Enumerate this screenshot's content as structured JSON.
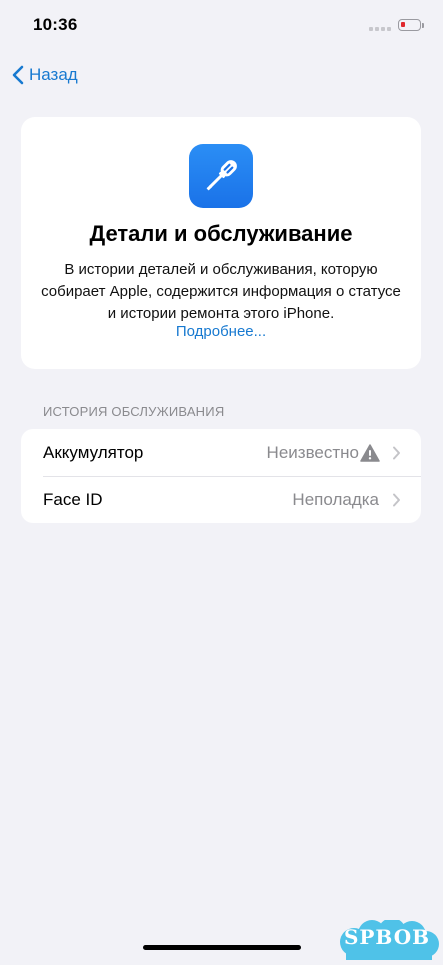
{
  "status_bar": {
    "time": "10:36"
  },
  "nav": {
    "back_label": "Назад"
  },
  "card": {
    "icon": "screwdriver-icon",
    "title": "Детали и обслуживание",
    "description": "В истории деталей и обслуживания, которую собирает Apple, содержится информация о статусе и истории ремонта этого iPhone.",
    "link": "Подробнее..."
  },
  "service_history": {
    "header": "ИСТОРИЯ ОБСЛУЖИВАНИЯ",
    "rows": [
      {
        "label": "Аккумулятор",
        "value": "Неизвестно",
        "icon": "warning-icon"
      },
      {
        "label": "Face ID",
        "value": "Неполадка"
      }
    ]
  },
  "watermark": {
    "text": "SPBOB"
  },
  "colors": {
    "background": "#f2f2f7",
    "accent": "#1779d0",
    "icon_blue": "#1a72e8",
    "battery_low": "#e0282e",
    "secondary_text": "#8a8a8e"
  }
}
